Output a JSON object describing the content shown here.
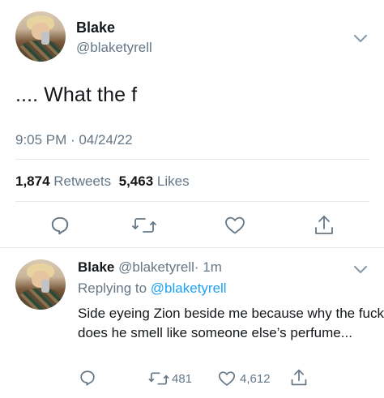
{
  "main_tweet": {
    "author_name": "Blake",
    "author_handle": "@blaketyrell",
    "text": ".... What the f",
    "timestamp": "9:05 PM · 04/24/22",
    "retweets_count": "1,874",
    "retweets_label": "Retweets",
    "likes_count": "5,463",
    "likes_label": "Likes",
    "icons": [
      "reply-icon",
      "retweet-icon",
      "like-icon",
      "share-icon",
      "chevron-down-icon"
    ]
  },
  "reply_tweet": {
    "author_name": "Blake",
    "author_handle": "@blaketyrell",
    "time": "· 1m",
    "replying_prefix": "Replying to",
    "replying_to": "@blaketyrell",
    "text": "Side eyeing Zion beside me because why the fuck does he smell like someone else’s perfume...",
    "retweets_count": "481",
    "likes_count": "4,612"
  },
  "colors": {
    "text": "#14171a",
    "secondary": "#657786",
    "link": "#1da1f2",
    "divider": "#e1e8ed"
  }
}
